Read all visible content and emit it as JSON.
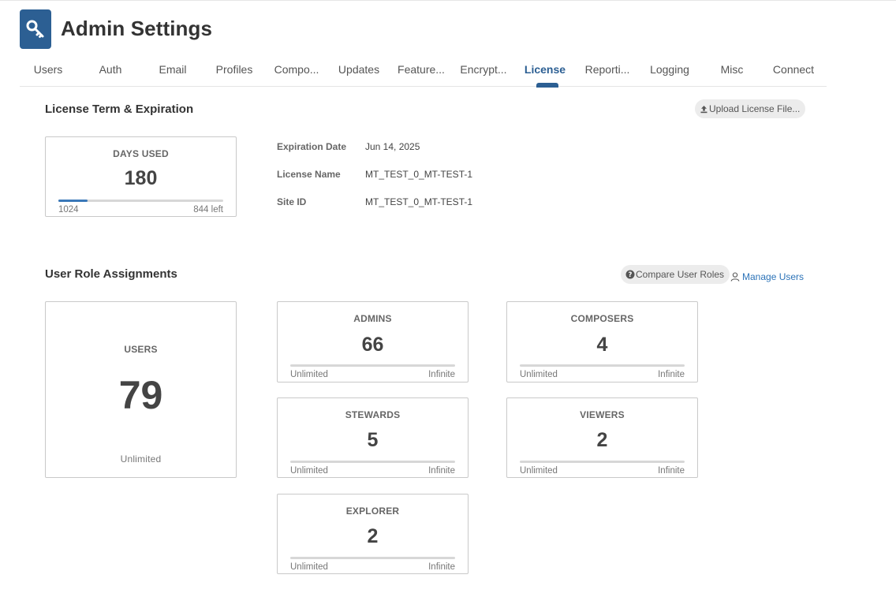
{
  "header": {
    "title": "Admin Settings",
    "icon": "key-icon",
    "accent_color": "#2c5f93"
  },
  "tabs": [
    {
      "label": "Users"
    },
    {
      "label": "Auth"
    },
    {
      "label": "Email"
    },
    {
      "label": "Profiles"
    },
    {
      "label": "Compo..."
    },
    {
      "label": "Updates"
    },
    {
      "label": "Feature..."
    },
    {
      "label": "Encrypt..."
    },
    {
      "label": "License",
      "active": true
    },
    {
      "label": "Reporti..."
    },
    {
      "label": "Logging"
    },
    {
      "label": "Misc"
    },
    {
      "label": "Connect"
    }
  ],
  "license": {
    "section_title": "License Term & Expiration",
    "upload_button": "Upload License File...",
    "days_used": {
      "label": "DAYS USED",
      "value": "180",
      "total": "1024",
      "remaining": "844 left",
      "progress": 0.176
    },
    "details": [
      {
        "label": "Expiration Date",
        "value": "Jun 14, 2025"
      },
      {
        "label": "License Name",
        "value": "MT_TEST_0_MT-TEST-1"
      },
      {
        "label": "Site ID",
        "value": "MT_TEST_0_MT-TEST-1"
      }
    ]
  },
  "roles": {
    "section_title": "User Role Assignments",
    "compare_button": "Compare User Roles",
    "manage_link": "Manage Users",
    "users": {
      "label": "USERS",
      "value": "79",
      "limit": "Unlimited"
    },
    "cards": [
      {
        "label": "ADMINS",
        "value": "66",
        "left": "Unlimited",
        "right": "Infinite"
      },
      {
        "label": "COMPOSERS",
        "value": "4",
        "left": "Unlimited",
        "right": "Infinite"
      },
      {
        "label": "STEWARDS",
        "value": "5",
        "left": "Unlimited",
        "right": "Infinite"
      },
      {
        "label": "VIEWERS",
        "value": "2",
        "left": "Unlimited",
        "right": "Infinite"
      },
      {
        "label": "EXPLORER",
        "value": "2",
        "left": "Unlimited",
        "right": "Infinite"
      }
    ]
  }
}
